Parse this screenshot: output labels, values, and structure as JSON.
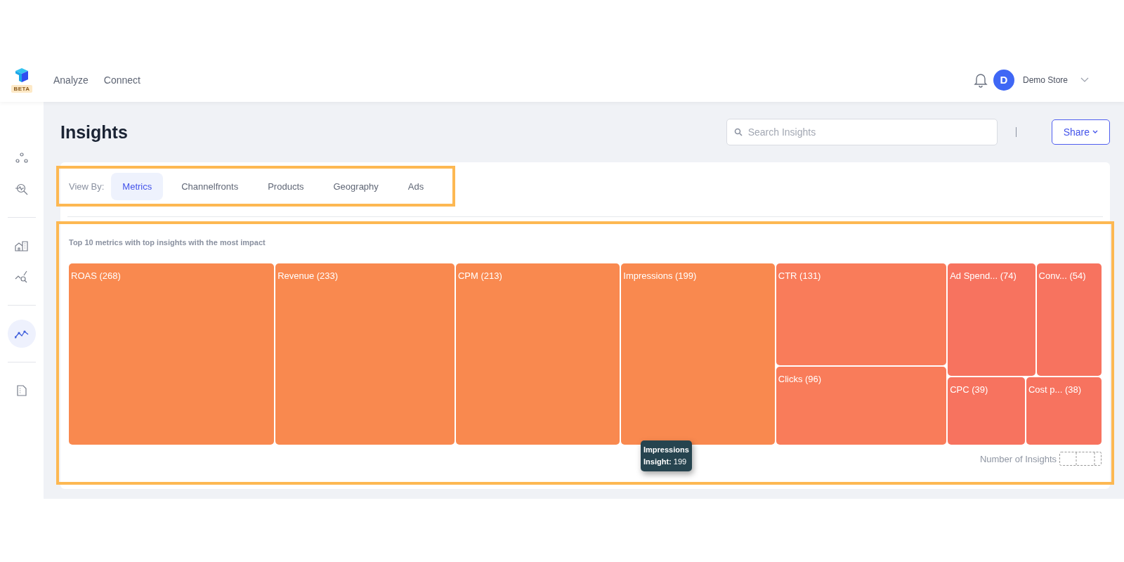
{
  "app": {
    "badge": "BETA"
  },
  "nav": [
    {
      "label": "Analyze",
      "selected": false
    },
    {
      "label": "Connect",
      "selected": false
    }
  ],
  "user": {
    "initial": "D",
    "name": "Demo Store"
  },
  "sidebar": {
    "groups": [
      {
        "items": [
          {
            "kind": "nodes",
            "selected": false
          },
          {
            "kind": "search-pulse",
            "selected": false
          }
        ]
      },
      {
        "items": [
          {
            "kind": "buildings",
            "selected": false
          },
          {
            "kind": "chart-search",
            "selected": false
          }
        ]
      },
      {
        "items": [
          {
            "kind": "trend",
            "selected": true
          }
        ]
      },
      {
        "items": [
          {
            "kind": "document",
            "selected": false
          }
        ]
      }
    ]
  },
  "page": {
    "title": "Insights",
    "search": {
      "placeholder": "Search Insights"
    },
    "share": "Share"
  },
  "view_by": {
    "label": "View By:",
    "tabs": [
      {
        "label": "Metrics",
        "selected": true
      },
      {
        "label": "Channelfronts",
        "selected": false
      },
      {
        "label": "Products",
        "selected": false
      },
      {
        "label": "Geography",
        "selected": false
      },
      {
        "label": "Ads",
        "selected": false
      }
    ]
  },
  "treemap": {
    "caption": "Top 10 metrics with top insights with the most impact",
    "tiles": [
      {
        "label": "ROAS (268)",
        "color": "#f9894f"
      },
      {
        "label": "Revenue (233)",
        "color": "#f9894f"
      },
      {
        "label": "CPM (213)",
        "color": "#f9894f"
      },
      {
        "label": "Impressions (199)",
        "color": "#f9894f"
      },
      {
        "label": "CTR (131)",
        "color": "#f97c5a"
      },
      {
        "label": "Clicks (96)",
        "color": "#f97c5a"
      },
      {
        "label": "Ad Spend... (74)",
        "color": "#f7735f"
      },
      {
        "label": "Conv... (54)",
        "color": "#f7735f"
      },
      {
        "label": "CPC (39)",
        "color": "#f7735f"
      },
      {
        "label": "Cost p... (38)",
        "color": "#f7735f"
      }
    ],
    "legend": "Number of Insights",
    "tooltip": {
      "title": "Impressions",
      "text": "**Insight:** 199"
    }
  }
}
